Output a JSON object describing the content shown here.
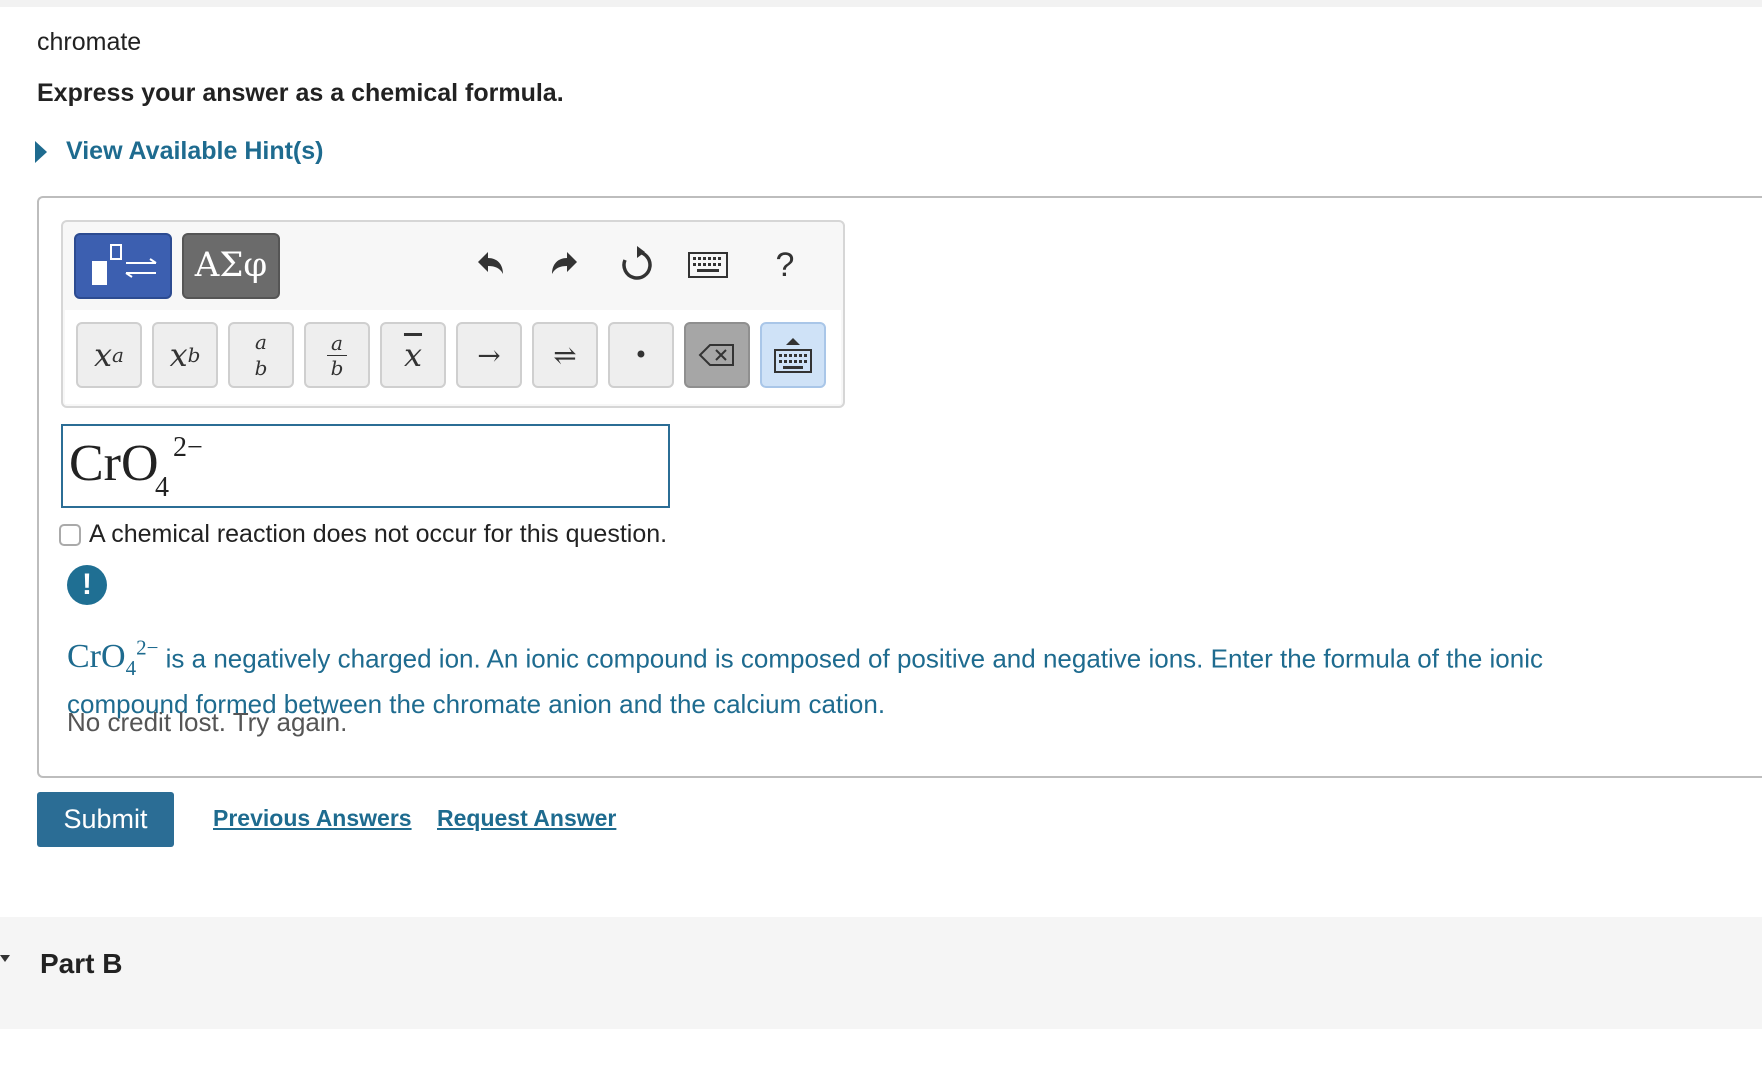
{
  "question": {
    "prompt": "chromate",
    "instruction": "Express your answer as a chemical formula."
  },
  "hint": {
    "label": "View Available Hint(s)"
  },
  "toolbar": {
    "templates_icon": "templates-icon",
    "symbols_label": "ΑΣφ",
    "undo_icon": "undo-icon",
    "redo_icon": "redo-icon",
    "reset_icon": "reset-icon",
    "keyboard_icon": "keyboard-icon",
    "help_label": "?",
    "keys": {
      "superscript": {
        "base": "x",
        "sup": "a"
      },
      "subscript": {
        "base": "x",
        "sub": "b"
      },
      "stacked": {
        "top": "a",
        "bottom": "b"
      },
      "fraction": {
        "top": "a",
        "bottom": "b"
      },
      "overbar": {
        "label": "x"
      },
      "arrow": {
        "label": "→"
      },
      "equilibrium": {
        "label": "⇌"
      },
      "dot": {
        "label": "•"
      },
      "backspace_icon": "backspace-icon",
      "keyboard_toggle_icon": "keyboard-toggle-icon"
    }
  },
  "answer": {
    "base": "CrO",
    "subscript": "4",
    "superscript": "2−"
  },
  "no_reaction": {
    "checked": false,
    "label": "A chemical reaction does not occur for this question."
  },
  "feedback": {
    "icon": "alert-icon",
    "formula_base": "CrO",
    "formula_sub": "4",
    "formula_sup": "2−",
    "message": " is a negatively charged ion. An ionic compound is composed of positive and negative ions. Enter the formula of the ionic compound formed between the chromate anion and the calcium cation.",
    "credit_note": "No credit lost. Try again."
  },
  "actions": {
    "submit_label": "Submit",
    "previous_answers_label": "Previous Answers",
    "request_answer_label": "Request Answer"
  },
  "next_part": {
    "title": "Part B"
  },
  "colors": {
    "link_blue": "#1e6b8f",
    "submit_blue": "#2b6d95",
    "templates_blue": "#3c5fb0"
  }
}
